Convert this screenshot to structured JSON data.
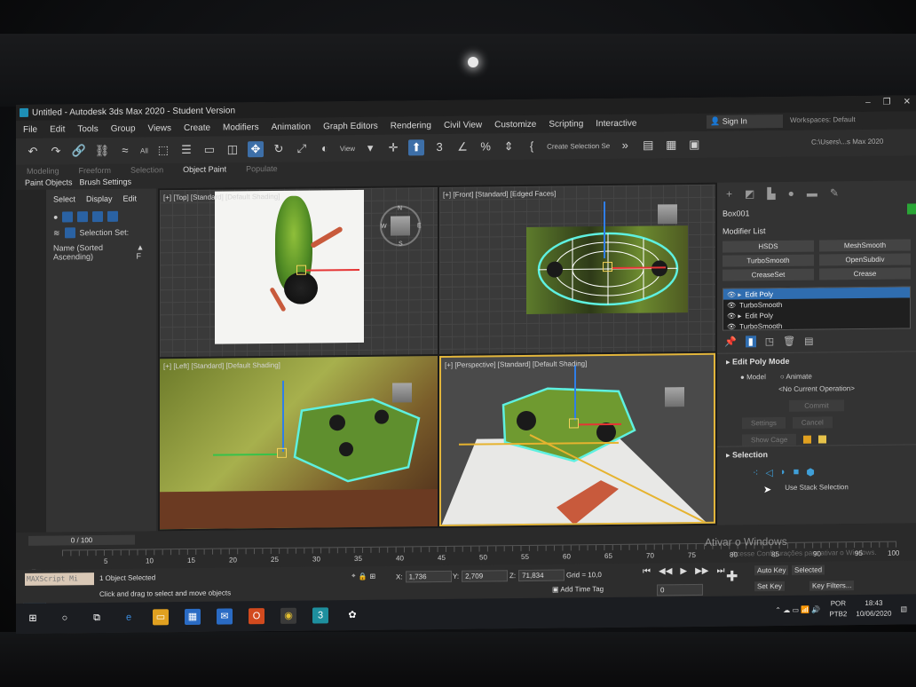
{
  "window": {
    "title": "Untitled - Autodesk 3ds Max 2020 - Student Version",
    "controls": [
      "–",
      "❐",
      "✕"
    ]
  },
  "menu": [
    "File",
    "Edit",
    "Tools",
    "Group",
    "Views",
    "Create",
    "Modifiers",
    "Animation",
    "Graph Editors",
    "Rendering",
    "Civil View",
    "Customize",
    "Scripting",
    "Interactive"
  ],
  "account": {
    "signin": "Sign In",
    "workspace": "Workspaces:  Default"
  },
  "toolbar": {
    "filter": "All",
    "view": "View",
    "selection_set": "Create Selection Se",
    "path": "C:\\Users\\...s Max 2020"
  },
  "ribbon": {
    "tabs": [
      "Modeling",
      "Freeform",
      "Selection",
      "Object Paint",
      "Populate"
    ],
    "active_tab": "Object Paint",
    "sub": [
      "Paint Objects",
      "Brush Settings"
    ]
  },
  "explorer": {
    "tabs": [
      "Select",
      "Display",
      "Edit"
    ],
    "selection_set": "Selection Set:",
    "sort": "Name (Sorted Ascending)",
    "sort_arrow": "▲ F"
  },
  "viewports": [
    {
      "label": "[+] [Top] [Standard] [Default Shading]",
      "active": false
    },
    {
      "label": "[+] [Front] [Standard] [Edged Faces]",
      "active": false
    },
    {
      "label": "[+] [Left] [Standard] [Default Shading]",
      "active": false
    },
    {
      "label": "[+] [Perspective] [Standard] [Default Shading]",
      "active": true
    }
  ],
  "compass": {
    "n": "N",
    "s": "S",
    "w": "W",
    "e": "E"
  },
  "command_panel": {
    "object_name": "Box001",
    "object_color": "#2aa636",
    "modifier_list": "Modifier List",
    "buttons": [
      "HSDS",
      "MeshSmooth",
      "TurboSmooth",
      "OpenSubdiv",
      "CreaseSet",
      "Crease"
    ],
    "stack": [
      "Edit Poly",
      "TurboSmooth",
      "Edit Poly",
      "TurboSmooth"
    ],
    "edit_poly_mode": "Edit Poly Mode",
    "model": "Model",
    "animate": "Animate",
    "no_op": "<No Current Operation>",
    "commit": "Commit",
    "settings": "Settings",
    "cancel": "Cancel",
    "show_cage": "Show Cage",
    "selection": "Selection",
    "use_stack": "Use Stack Selection"
  },
  "timeline": {
    "slider": "0 / 100",
    "ticks": [
      "5",
      "10",
      "15",
      "20",
      "25",
      "30",
      "35",
      "40",
      "45",
      "50",
      "55",
      "60",
      "65",
      "70",
      "75",
      "80",
      "85",
      "90",
      "95",
      "100"
    ]
  },
  "status": {
    "maxscript": "MAXScript Mi",
    "selected": "1 Object Selected",
    "prompt": "Click and drag to select and move objects",
    "x": "1,736",
    "y": "2,709",
    "z": "71,834",
    "grid": "Grid = 10,0",
    "add_time_tag": "Add Time Tag",
    "frame": "0",
    "auto_key": "Auto Key",
    "selected_key": "Selected",
    "set_key": "Set Key",
    "key_filters": "Key Filters...",
    "watermark": "Ativar o Windows",
    "watermark_sub": "Acesse Configurações para ativar o Windows."
  },
  "taskbar": {
    "lang": "POR",
    "layout": "PTB2",
    "time": "18:43",
    "date": "10/06/2020"
  }
}
